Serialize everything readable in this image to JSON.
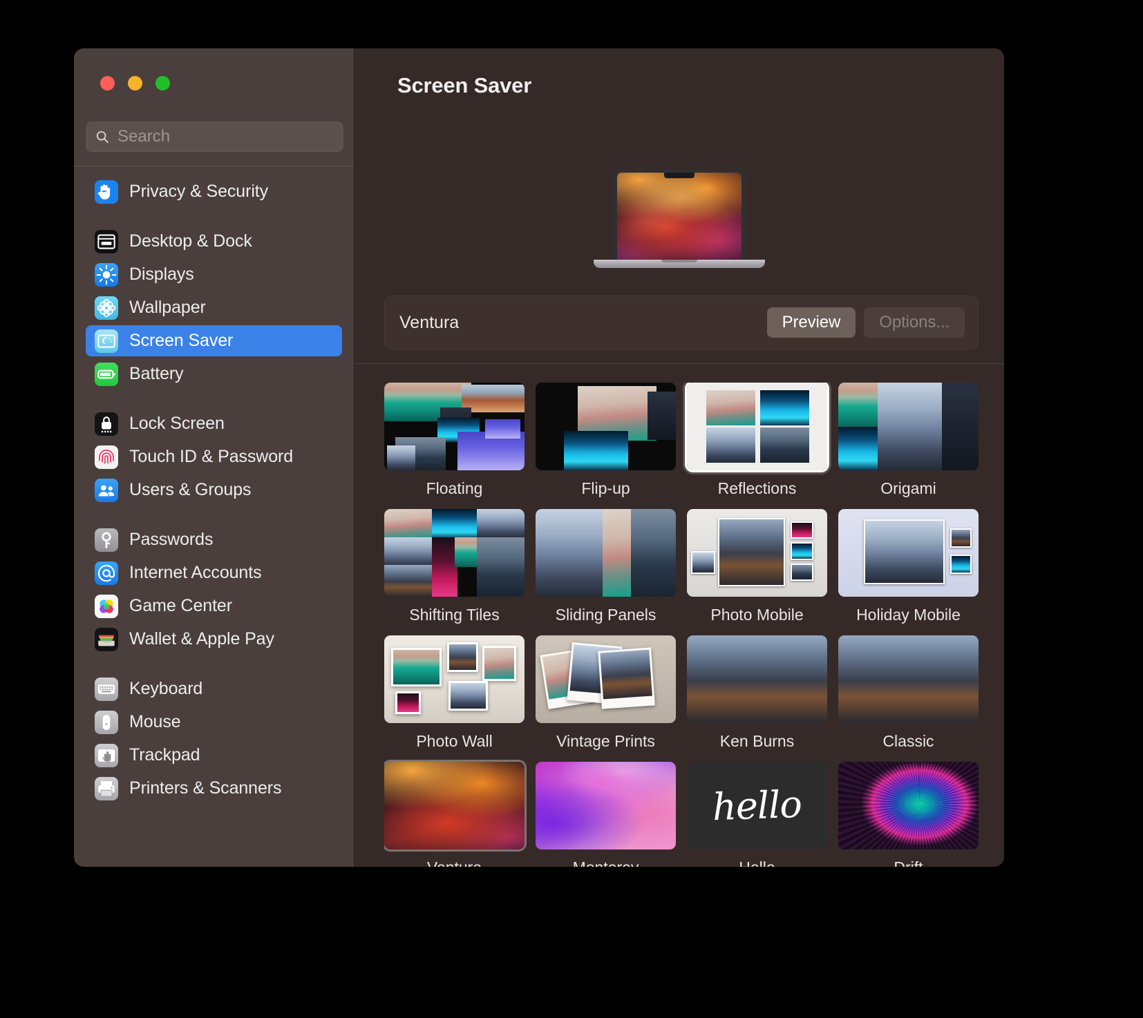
{
  "window": {
    "traffic_lights": [
      "close",
      "minimize",
      "zoom"
    ]
  },
  "sidebar": {
    "search": {
      "placeholder": "Search",
      "value": ""
    },
    "groups": [
      {
        "items": [
          {
            "label": "Privacy & Security",
            "icon": "hand-raised-icon",
            "selected": false
          }
        ]
      },
      {
        "items": [
          {
            "label": "Desktop & Dock",
            "icon": "desktop-dock-icon",
            "selected": false
          },
          {
            "label": "Displays",
            "icon": "brightness-icon",
            "selected": false
          },
          {
            "label": "Wallpaper",
            "icon": "flower-icon",
            "selected": false
          },
          {
            "label": "Screen Saver",
            "icon": "screen-saver-icon",
            "selected": true
          },
          {
            "label": "Battery",
            "icon": "battery-icon",
            "selected": false
          }
        ]
      },
      {
        "items": [
          {
            "label": "Lock Screen",
            "icon": "lock-icon",
            "selected": false
          },
          {
            "label": "Touch ID & Password",
            "icon": "fingerprint-icon",
            "selected": false
          },
          {
            "label": "Users & Groups",
            "icon": "users-icon",
            "selected": false
          }
        ]
      },
      {
        "items": [
          {
            "label": "Passwords",
            "icon": "key-icon",
            "selected": false
          },
          {
            "label": "Internet Accounts",
            "icon": "at-sign-icon",
            "selected": false
          },
          {
            "label": "Game Center",
            "icon": "game-center-icon",
            "selected": false
          },
          {
            "label": "Wallet & Apple Pay",
            "icon": "wallet-icon",
            "selected": false
          }
        ]
      },
      {
        "items": [
          {
            "label": "Keyboard",
            "icon": "keyboard-icon",
            "selected": false
          },
          {
            "label": "Mouse",
            "icon": "mouse-icon",
            "selected": false
          },
          {
            "label": "Trackpad",
            "icon": "trackpad-icon",
            "selected": false
          },
          {
            "label": "Printers & Scanners",
            "icon": "printer-icon",
            "selected": false
          }
        ]
      }
    ]
  },
  "detail": {
    "title": "Screen Saver",
    "current": {
      "name": "Ventura",
      "preview_label": "Preview",
      "options_label": "Options...",
      "options_disabled": true
    },
    "grid": [
      {
        "label": "Floating",
        "art": "floating",
        "selected": false
      },
      {
        "label": "Flip-up",
        "art": "flipup",
        "selected": false
      },
      {
        "label": "Reflections",
        "art": "reflections",
        "selected": false
      },
      {
        "label": "Origami",
        "art": "origami",
        "selected": false
      },
      {
        "label": "Shifting Tiles",
        "art": "shifting",
        "selected": false
      },
      {
        "label": "Sliding Panels",
        "art": "sliding",
        "selected": false
      },
      {
        "label": "Photo Mobile",
        "art": "photomobile",
        "selected": false
      },
      {
        "label": "Holiday Mobile",
        "art": "holidaymobile",
        "selected": false
      },
      {
        "label": "Photo Wall",
        "art": "photowall",
        "selected": false
      },
      {
        "label": "Vintage Prints",
        "art": "vintage",
        "selected": false
      },
      {
        "label": "Ken Burns",
        "art": "kenburns",
        "selected": false
      },
      {
        "label": "Classic",
        "art": "classic",
        "selected": false
      },
      {
        "label": "Ventura",
        "art": "ventura",
        "selected": true
      },
      {
        "label": "Monterey",
        "art": "monterey",
        "selected": false
      },
      {
        "label": "Hello",
        "art": "hello",
        "selected": false
      },
      {
        "label": "Drift",
        "art": "drift",
        "selected": false
      }
    ],
    "hello_word": "hello"
  },
  "colors": {
    "accent": "#3b82e8",
    "sidebar_bg": "#4a3f3c",
    "detail_bg": "#352a28",
    "traffic_red": "#ff5f57",
    "traffic_yellow": "#f5b32c",
    "traffic_green": "#22bf2b"
  }
}
